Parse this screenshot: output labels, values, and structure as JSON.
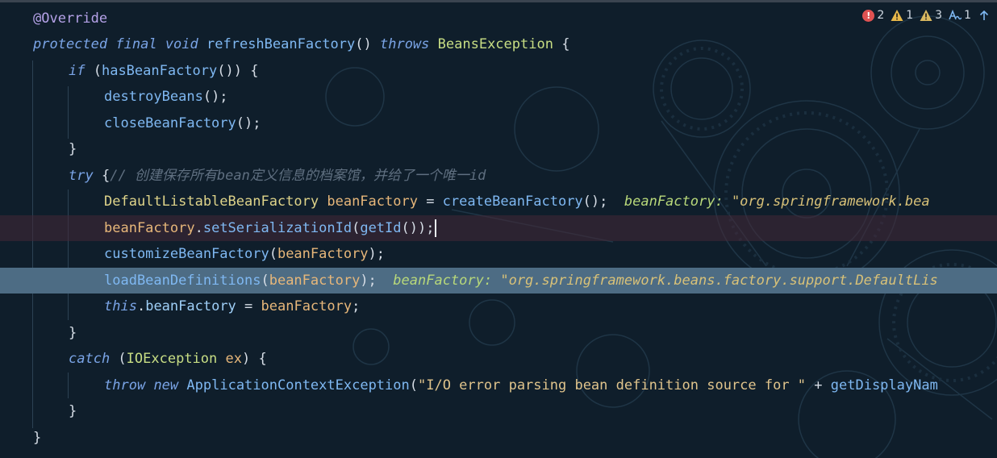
{
  "inspections": {
    "errors": "2",
    "warnings": "1",
    "weak_warnings": "3",
    "typos": "1",
    "colors": {
      "error": "#e05252",
      "warning": "#e8b84a",
      "typo": "#7fb8f2"
    }
  },
  "code": {
    "l1": {
      "annotation": "@Override"
    },
    "l2": {
      "mod1": "protected",
      "mod2": "final",
      "ret": "void",
      "name": "refreshBeanFactory",
      "parens": "()",
      "throws_kw": "throws",
      "exc": "BeansException",
      "brace": " {"
    },
    "l3": {
      "kw": "if",
      "p1": " (",
      "call": "hasBeanFactory",
      "p2": "()) {"
    },
    "l4": {
      "call": "destroyBeans",
      "rest": "();"
    },
    "l5": {
      "call": "closeBeanFactory",
      "rest": "();"
    },
    "l6": {
      "text": "}"
    },
    "l7": {
      "kw": "try",
      "brace": " {",
      "comment": "// 创建保存所有bean定义信息的档案馆，并给了一个唯一id"
    },
    "l8": {
      "type": "DefaultListableBeanFactory",
      "var": "beanFactory",
      "eq": " = ",
      "call": "createBeanFactory",
      "rest": "();",
      "hint_key": "beanFactory: ",
      "hint_val": "\"org.springframework.bea"
    },
    "l9": {
      "var": "beanFactory",
      "dot": ".",
      "call": "setSerializationId",
      "p1": "(",
      "call2": "getId",
      "rest": "());"
    },
    "l10": {
      "call": "customizeBeanFactory",
      "p1": "(",
      "arg": "beanFactory",
      "rest": ");"
    },
    "l11": {
      "call": "loadBeanDefinitions",
      "p1": "(",
      "arg": "beanFactory",
      "rest": ");",
      "hint_key": "beanFactory: ",
      "hint_val": "\"org.springframework.beans.factory.support.DefaultLis"
    },
    "l12": {
      "kw": "this",
      "dot": ".",
      "field": "beanFactory",
      "eq": " = ",
      "var": "beanFactory",
      "semi": ";"
    },
    "l13": {
      "text": "}"
    },
    "l14": {
      "kw": "catch",
      "p1": " (",
      "exc": "IOException",
      "var": " ex",
      "rest": ") {"
    },
    "l15": {
      "kw1": "throw",
      "kw2": "new",
      "cls": "ApplicationContextException",
      "p1": "(",
      "str": "\"I/O error parsing bean definition source for \"",
      "plus": " + ",
      "call": "getDisplayNam"
    },
    "l16": {
      "text": "}"
    },
    "l17": {
      "text": "}"
    }
  }
}
